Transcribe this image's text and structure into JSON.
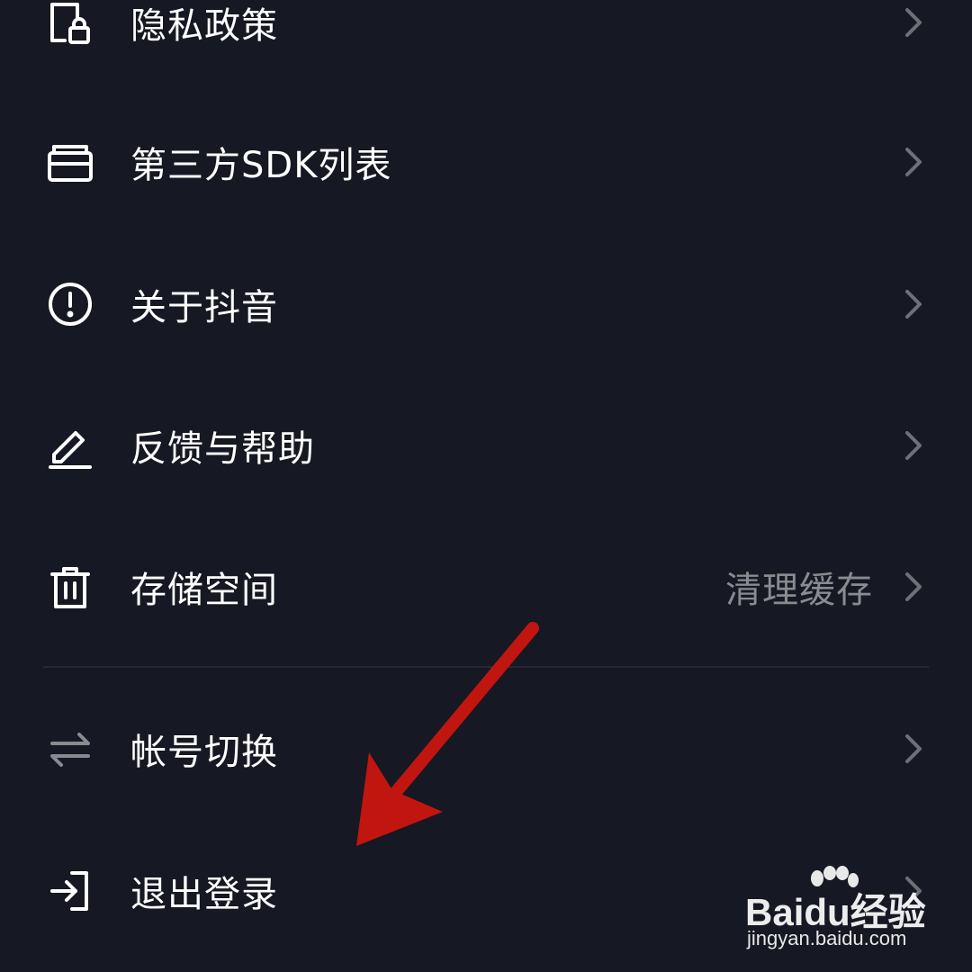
{
  "settings": {
    "items": [
      {
        "label": "隐私政策",
        "icon": "privacy-lock-icon"
      },
      {
        "label": "第三方SDK列表",
        "icon": "toolbox-icon"
      },
      {
        "label": "关于抖音",
        "icon": "info-circle-icon"
      },
      {
        "label": "反馈与帮助",
        "icon": "pencil-icon"
      },
      {
        "label": "存储空间",
        "value": "清理缓存",
        "icon": "trash-icon"
      },
      {
        "label": "帐号切换",
        "icon": "switch-arrows-icon"
      },
      {
        "label": "退出登录",
        "icon": "logout-icon"
      }
    ]
  },
  "watermark": {
    "brand": "Baidu经验",
    "url": "jingyan.baidu.com"
  },
  "colors": {
    "background": "#161823",
    "text": "#ffffff",
    "secondary_text": "#8a8b91",
    "annotation_arrow": "#c0160f"
  }
}
